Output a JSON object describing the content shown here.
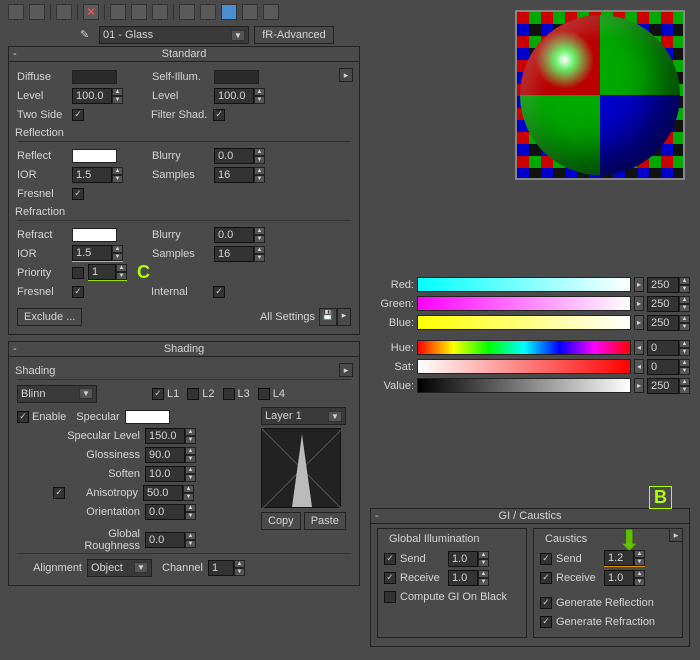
{
  "toolbar": {
    "icons": [
      "a",
      "b",
      "c",
      "d",
      "e",
      "f",
      "g",
      "h",
      "i",
      "j",
      "k",
      "l",
      "m",
      "n"
    ]
  },
  "material": {
    "name": "01 - Glass",
    "type": "fR-Advanced"
  },
  "standard": {
    "title": "Standard",
    "diffuse": "Diffuse",
    "diffuse_swatch": "#2a2a2a",
    "level": "Level",
    "level_v": "100.0",
    "selfillum": "Self-Illum.",
    "selfillum_swatch": "#2a2a2a",
    "level2_v": "100.0",
    "twoside": "Two Side",
    "twoside_on": true,
    "filtershad": "Filter Shad.",
    "filtershad_on": true,
    "reflection": "Reflection",
    "reflect": "Reflect",
    "reflect_swatch": "#ffffff",
    "blurry": "Blurry",
    "blurry_v": "0.0",
    "ior": "IOR",
    "ior_v": "1.5",
    "samples": "Samples",
    "samples_v": "16",
    "fresnel": "Fresnel",
    "fresnel_on": true,
    "refraction": "Refraction",
    "refract": "Refract",
    "refract_swatch": "#ffffff",
    "blurry2_v": "0.0",
    "ior2_v": "1.5",
    "samples2_v": "16",
    "priority": "Priority",
    "priority_v": "1",
    "fresnel2_on": true,
    "internal": "Internal",
    "internal_on": true,
    "exclude": "Exclude ...",
    "allsettings": "All Settings"
  },
  "shading": {
    "title": "Shading",
    "header": "Shading",
    "model": "Blinn",
    "l1": "L1",
    "l2": "L2",
    "l3": "L3",
    "l4": "L4",
    "l1_on": true,
    "l2_on": false,
    "l3_on": false,
    "l4_on": false,
    "enable": "Enable",
    "enable_on": true,
    "specular": "Specular",
    "specular_swatch": "#ffffff",
    "layer": "Layer 1",
    "speclvl": "Specular Level",
    "speclvl_v": "150.0",
    "gloss": "Glossiness",
    "gloss_v": "90.0",
    "soften": "Soften",
    "soften_v": "10.0",
    "aniso": "Anisotropy",
    "aniso_on": true,
    "aniso_v": "50.0",
    "orient": "Orientation",
    "orient_v": "0.0",
    "grough": "Global Roughness",
    "grough_v": "0.0",
    "copy": "Copy",
    "paste": "Paste",
    "alignment": "Alignment",
    "align_v": "Object",
    "channel": "Channel",
    "channel_v": "1"
  },
  "color": {
    "red": "Red:",
    "red_v": "250",
    "green": "Green:",
    "green_v": "250",
    "blue": "Blue:",
    "blue_v": "250",
    "hue": "Hue:",
    "hue_v": "0",
    "sat": "Sat:",
    "sat_v": "0",
    "value": "Value:",
    "value_v": "250"
  },
  "gi": {
    "title": "GI / Caustics",
    "global": "Global Illumination",
    "caustics": "Caustics",
    "send": "Send",
    "send_v": "1.0",
    "send2_v": "1.2",
    "receive": "Receive",
    "receive_v": "1.0",
    "receive2_v": "1.0",
    "send_on": true,
    "receive_on": true,
    "send2_on": true,
    "receive2_on": true,
    "compute": "Compute GI On Black",
    "compute_on": false,
    "genrefl": "Generate Reflection",
    "genrefl_on": true,
    "genrefr": "Generate Refraction",
    "genrefr_on": true
  },
  "marks": {
    "c": "C",
    "b": "B"
  }
}
